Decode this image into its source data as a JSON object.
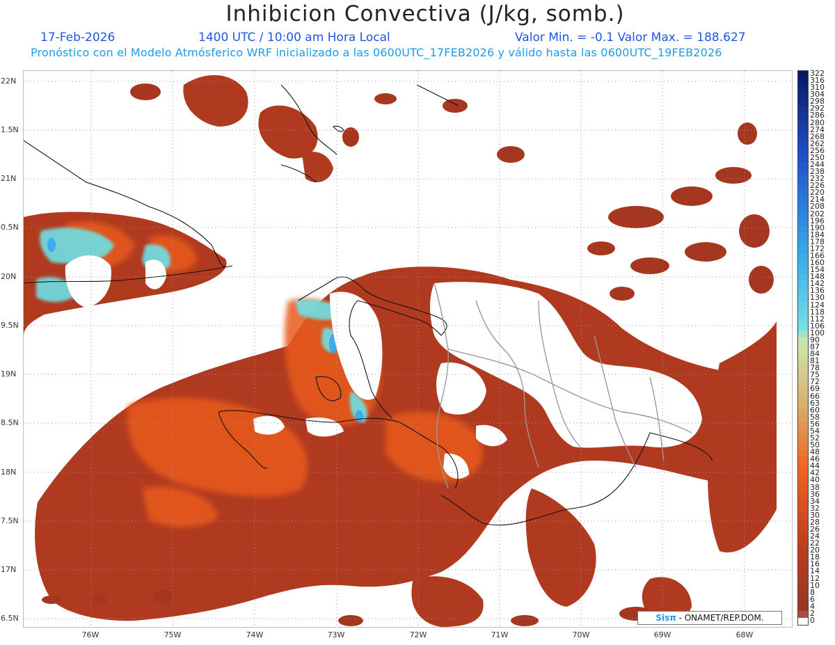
{
  "header": {
    "title": "Inhibicion Convectiva (J/kg, somb.)",
    "date": "17-Feb-2026",
    "time": "1400 UTC / 10:00 am Hora Local",
    "minmax": "Valor Min. = -0.1  Valor Max. = 188.627",
    "description": "Pronóstico con el Modelo Atmósferico WRF inicializado a las 0600UTC_17FEB2026 y válido hasta las  0600UTC_19FEB2026"
  },
  "axes": {
    "lat_labels": [
      "22N",
      "1.5N",
      "21N",
      "0.5N",
      "20N",
      "9.5N",
      "19N",
      "8.5N",
      "18N",
      "7.5N",
      "17N",
      "6.5N"
    ],
    "lon_labels": [
      "76W",
      "75W",
      "74W",
      "73W",
      "72W",
      "71W",
      "70W",
      "69W",
      "68W"
    ]
  },
  "colorbar": {
    "labels": [
      "322",
      "316",
      "310",
      "304",
      "298",
      "292",
      "286",
      "280",
      "274",
      "268",
      "262",
      "256",
      "250",
      "244",
      "238",
      "232",
      "226",
      "220",
      "214",
      "208",
      "202",
      "196",
      "190",
      "184",
      "178",
      "172",
      "166",
      "160",
      "154",
      "148",
      "142",
      "136",
      "130",
      "124",
      "118",
      "112",
      "106",
      "100",
      "90",
      "87",
      "84",
      "81",
      "78",
      "75",
      "72",
      "69",
      "66",
      "63",
      "60",
      "58",
      "56",
      "54",
      "52",
      "50",
      "48",
      "46",
      "44",
      "42",
      "40",
      "38",
      "36",
      "34",
      "32",
      "30",
      "28",
      "26",
      "24",
      "22",
      "20",
      "18",
      "16",
      "14",
      "12",
      "10",
      "8",
      "6",
      "4",
      "2",
      "0"
    ],
    "colors": {
      "navy": "#071a66",
      "blue": "#1f52c8",
      "light_blue": "#35a6ee",
      "cyan": "#6ee0e6",
      "pale_green": "#cfe6a8",
      "tan": "#d9b070",
      "orange": "#f0641e",
      "rust": "#c2411e",
      "dark_rust": "#963422",
      "zero": "#ffffff"
    }
  },
  "credit": {
    "sis": "Sisπ",
    "text": " - ONAMET/REP.DOM."
  }
}
